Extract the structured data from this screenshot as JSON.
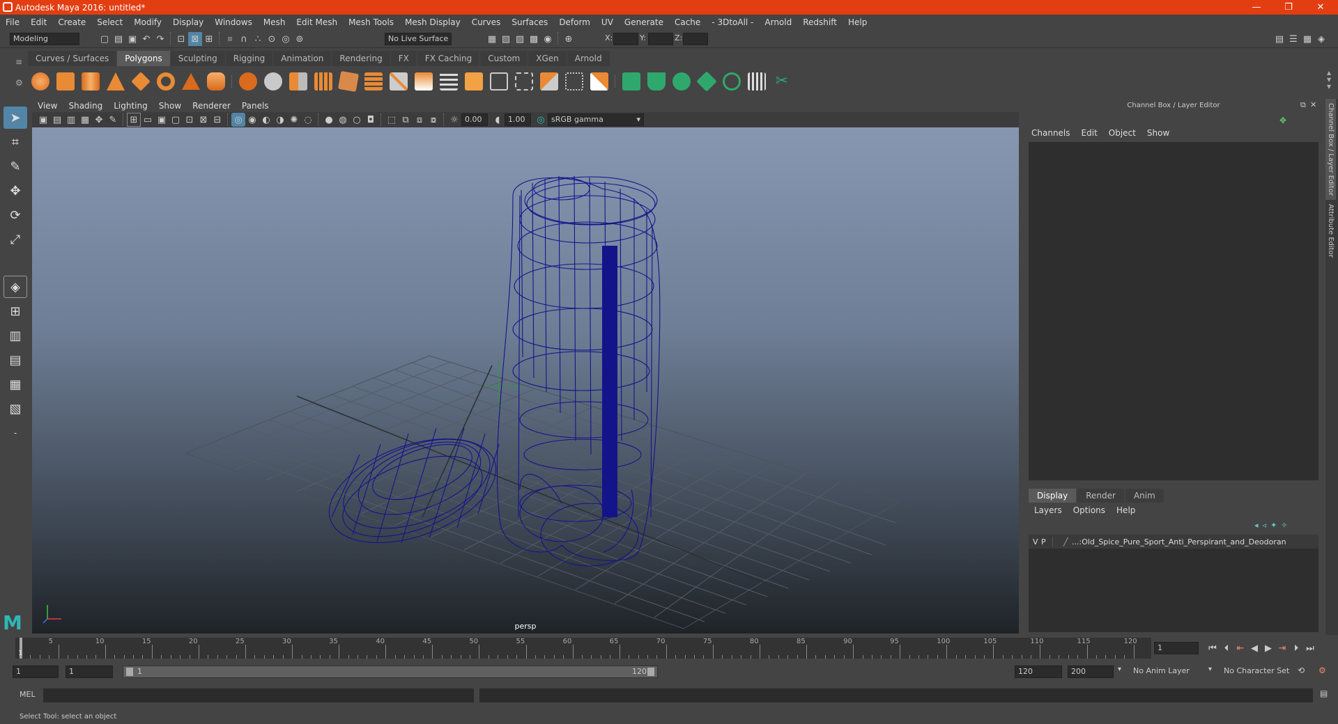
{
  "title_bar": {
    "title": "Autodesk Maya 2016: untitled*",
    "minimize": "—",
    "restore": "❐",
    "close": "✕"
  },
  "menu": [
    "File",
    "Edit",
    "Create",
    "Select",
    "Modify",
    "Display",
    "Windows",
    "Mesh",
    "Edit Mesh",
    "Mesh Tools",
    "Mesh Display",
    "Curves",
    "Surfaces",
    "Deform",
    "UV",
    "Generate",
    "Cache",
    "- 3DtoAll -",
    "Arnold",
    "Redshift",
    "Help"
  ],
  "status_line": {
    "mode": "Modeling",
    "live_surface": "No Live Surface",
    "x_label": "X:",
    "y_label": "Y:",
    "z_label": "Z:"
  },
  "shelf_tabs": [
    "Curves / Surfaces",
    "Polygons",
    "Sculpting",
    "Rigging",
    "Animation",
    "Rendering",
    "FX",
    "FX Caching",
    "Custom",
    "XGen",
    "Arnold"
  ],
  "shelf_active": "Polygons",
  "viewport": {
    "menu": [
      "View",
      "Shading",
      "Lighting",
      "Show",
      "Renderer",
      "Panels"
    ],
    "near_value": "0.00",
    "far_value": "1.00",
    "color_space": "sRGB gamma",
    "camera_label": "persp"
  },
  "channel_box": {
    "title": "Channel Box / Layer Editor",
    "menu": [
      "Channels",
      "Edit",
      "Object",
      "Show"
    ]
  },
  "layer_editor": {
    "tabs": [
      "Display",
      "Render",
      "Anim"
    ],
    "active_tab": "Display",
    "menu": [
      "Layers",
      "Options",
      "Help"
    ],
    "layer": {
      "v": "V",
      "p": "P",
      "name": "...:Old_Spice_Pure_Sport_Anti_Perspirant_and_Deodoran"
    }
  },
  "side_tabs": [
    "Channel Box / Layer Editor",
    "Attribute Editor"
  ],
  "time_slider": {
    "ticks": [
      "5",
      "10",
      "15",
      "20",
      "25",
      "30",
      "35",
      "40",
      "45",
      "50",
      "55",
      "60",
      "65",
      "70",
      "75",
      "80",
      "85",
      "90",
      "95",
      "100",
      "105",
      "110",
      "115",
      "120"
    ],
    "start_label": "1",
    "current_frame": "1"
  },
  "range": {
    "start": "1",
    "start_inner": "1",
    "slider_start": "1",
    "slider_end": "120",
    "end_inner": "120",
    "end": "200",
    "anim_layer": "No Anim Layer",
    "char_set": "No Character Set"
  },
  "mel": {
    "label": "MEL"
  },
  "help_line": "Select Tool: select an object",
  "colors": {
    "title_bar": "#e23e12",
    "wireframe": "#14148a",
    "selected_tool": "#5285a6"
  }
}
